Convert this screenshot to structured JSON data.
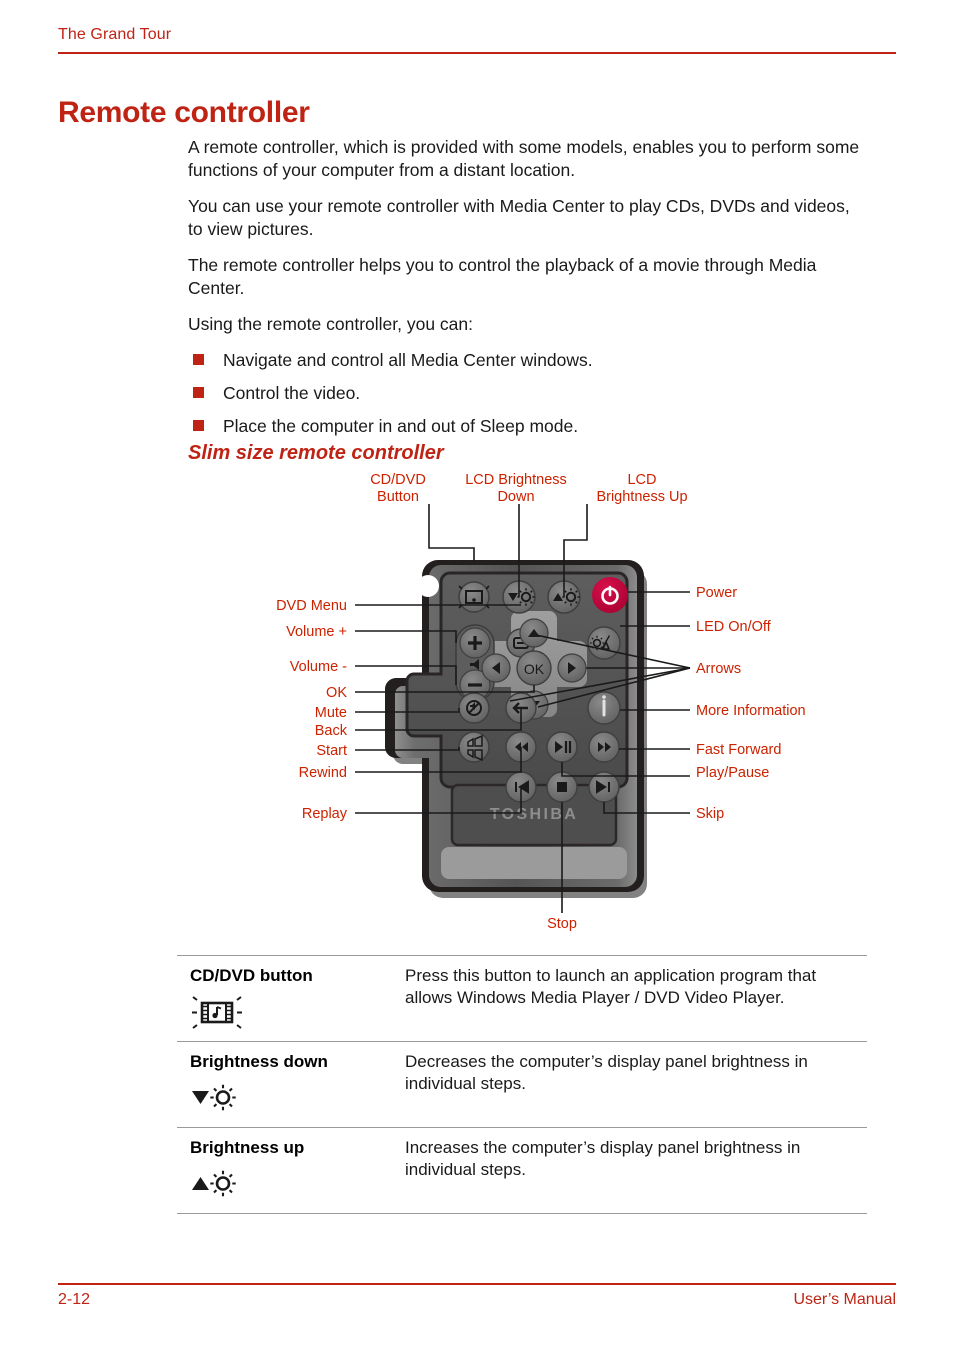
{
  "header": {
    "running_head": "The Grand Tour",
    "rule_color": "#BF2314"
  },
  "page_title": "Remote controller",
  "body": {
    "paragraphs": [
      "A remote controller, which is provided with some models, enables you to perform some functions of your computer from a distant location.",
      "You can use your remote controller with Media Center to play CDs, DVDs and videos, to view pictures.",
      "The remote controller helps you to control the playback of a movie through Media Center.",
      "Using the remote controller, you can:"
    ],
    "bullets": [
      "Navigate and control all Media Center windows.",
      "Control the video.",
      "Place the computer in and out of Sleep mode."
    ]
  },
  "sub_heading": "Slim size remote controller",
  "figure": {
    "brand": "TOSHIBA",
    "ok_label": "OK",
    "callouts_top": [
      {
        "name": "cd-dvd-button",
        "lines": [
          "CD/DVD",
          "Button"
        ]
      },
      {
        "name": "lcd-brightness-down",
        "lines": [
          "LCD Brightness",
          "Down"
        ]
      },
      {
        "name": "lcd-brightness-up",
        "lines": [
          "LCD",
          "Brightness Up"
        ]
      }
    ],
    "callouts_left": [
      {
        "name": "dvd-menu",
        "label": "DVD Menu"
      },
      {
        "name": "volume-up",
        "label": "Volume +"
      },
      {
        "name": "volume-down",
        "label": "Volume -"
      },
      {
        "name": "ok",
        "label": "OK"
      },
      {
        "name": "mute",
        "label": "Mute"
      },
      {
        "name": "back",
        "label": "Back"
      },
      {
        "name": "start",
        "label": "Start"
      },
      {
        "name": "rewind",
        "label": "Rewind"
      },
      {
        "name": "replay",
        "label": "Replay"
      }
    ],
    "callouts_right": [
      {
        "name": "power",
        "label": "Power"
      },
      {
        "name": "led-on-off",
        "label": "LED On/Off"
      },
      {
        "name": "arrows",
        "label": "Arrows"
      },
      {
        "name": "more-information",
        "label": "More Information"
      },
      {
        "name": "fast-forward",
        "label": "Fast Forward"
      },
      {
        "name": "play-pause",
        "label": "Play/Pause"
      },
      {
        "name": "skip",
        "label": "Skip"
      }
    ],
    "callouts_bottom": [
      {
        "name": "stop",
        "label": "Stop"
      }
    ],
    "colors": {
      "callout_text": "#CC2200",
      "power_button": "#C8003C",
      "body_dark": "#4a4a4a",
      "body_light": "#a8a8a8"
    }
  },
  "table": {
    "rows": [
      {
        "term": "CD/DVD button",
        "icon": "film-music-icon",
        "description": "Press this button to launch an application program that allows Windows Media Player / DVD Video Player."
      },
      {
        "term": "Brightness down",
        "icon": "brightness-down-icon",
        "description": "Decreases the computer’s display panel brightness in individual steps."
      },
      {
        "term": "Brightness up",
        "icon": "brightness-up-icon",
        "description": "Increases the computer’s display panel brightness in individual steps."
      }
    ]
  },
  "footer": {
    "page_number": "2-12",
    "manual_label": "User’s Manual"
  }
}
